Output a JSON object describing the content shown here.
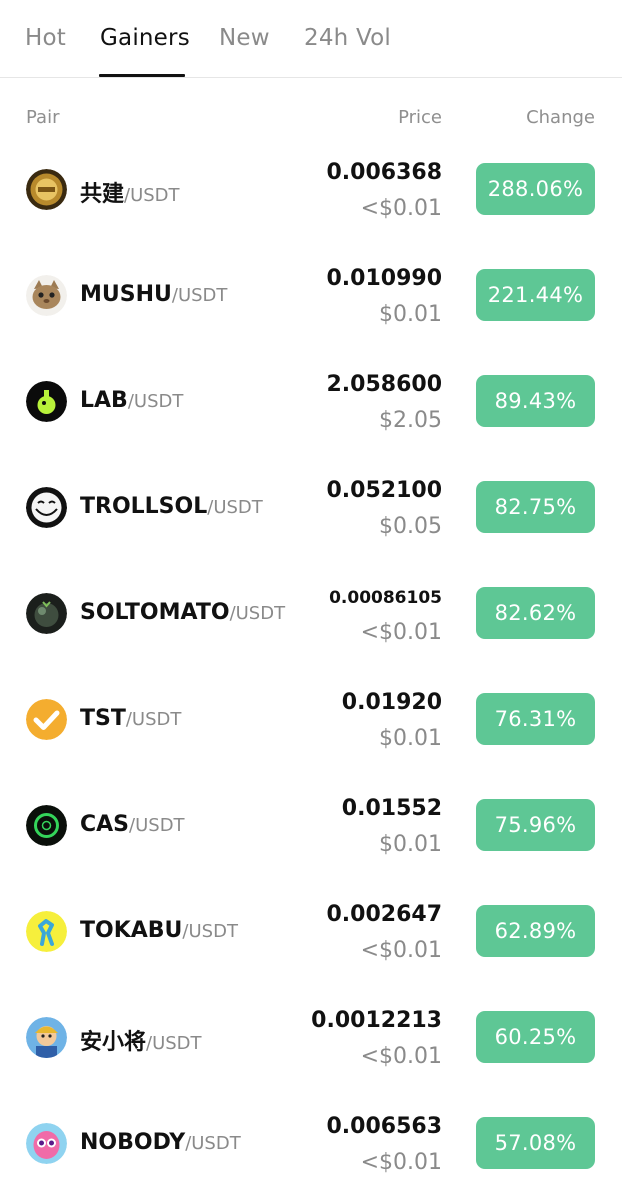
{
  "tabs": [
    {
      "label": "Hot",
      "active": false
    },
    {
      "label": "Gainers",
      "active": true
    },
    {
      "label": "New",
      "active": false
    },
    {
      "label": "24h Vol",
      "active": false
    }
  ],
  "columns": {
    "pair": "Pair",
    "price": "Price",
    "change": "Change"
  },
  "colors": {
    "positive": "#5ec795",
    "muted": "#8a8a8a",
    "text": "#111111"
  },
  "rows": [
    {
      "base": "共建",
      "quote": "/USDT",
      "price": "0.006368",
      "fiat": "<$0.01",
      "change": "288.06%",
      "icon": "gold-coin-icon"
    },
    {
      "base": "MUSHU",
      "quote": "/USDT",
      "price": "0.010990",
      "fiat": "$0.01",
      "change": "221.44%",
      "icon": "cat-icon"
    },
    {
      "base": "LAB",
      "quote": "/USDT",
      "price": "2.058600",
      "fiat": "$2.05",
      "change": "89.43%",
      "icon": "flask-icon"
    },
    {
      "base": "TROLLSOL",
      "quote": "/USDT",
      "price": "0.052100",
      "fiat": "$0.05",
      "change": "82.75%",
      "icon": "trollface-icon"
    },
    {
      "base": "SOLTOMATO",
      "quote": "/USDT",
      "price": "0.00086105",
      "fiat": "<$0.01",
      "change": "82.62%",
      "icon": "tomato-icon"
    },
    {
      "base": "TST",
      "quote": "/USDT",
      "price": "0.01920",
      "fiat": "$0.01",
      "change": "76.31%",
      "icon": "checkmark-icon"
    },
    {
      "base": "CAS",
      "quote": "/USDT",
      "price": "0.01552",
      "fiat": "$0.01",
      "change": "75.96%",
      "icon": "ring-icon"
    },
    {
      "base": "TOKABU",
      "quote": "/USDT",
      "price": "0.002647",
      "fiat": "<$0.01",
      "change": "62.89%",
      "icon": "dino-icon"
    },
    {
      "base": "安小将",
      "quote": "/USDT",
      "price": "0.0012213",
      "fiat": "<$0.01",
      "change": "60.25%",
      "icon": "cartoon-boy-icon"
    },
    {
      "base": "NOBODY",
      "quote": "/USDT",
      "price": "0.006563",
      "fiat": "<$0.01",
      "change": "57.08%",
      "icon": "pink-mascot-icon"
    }
  ]
}
